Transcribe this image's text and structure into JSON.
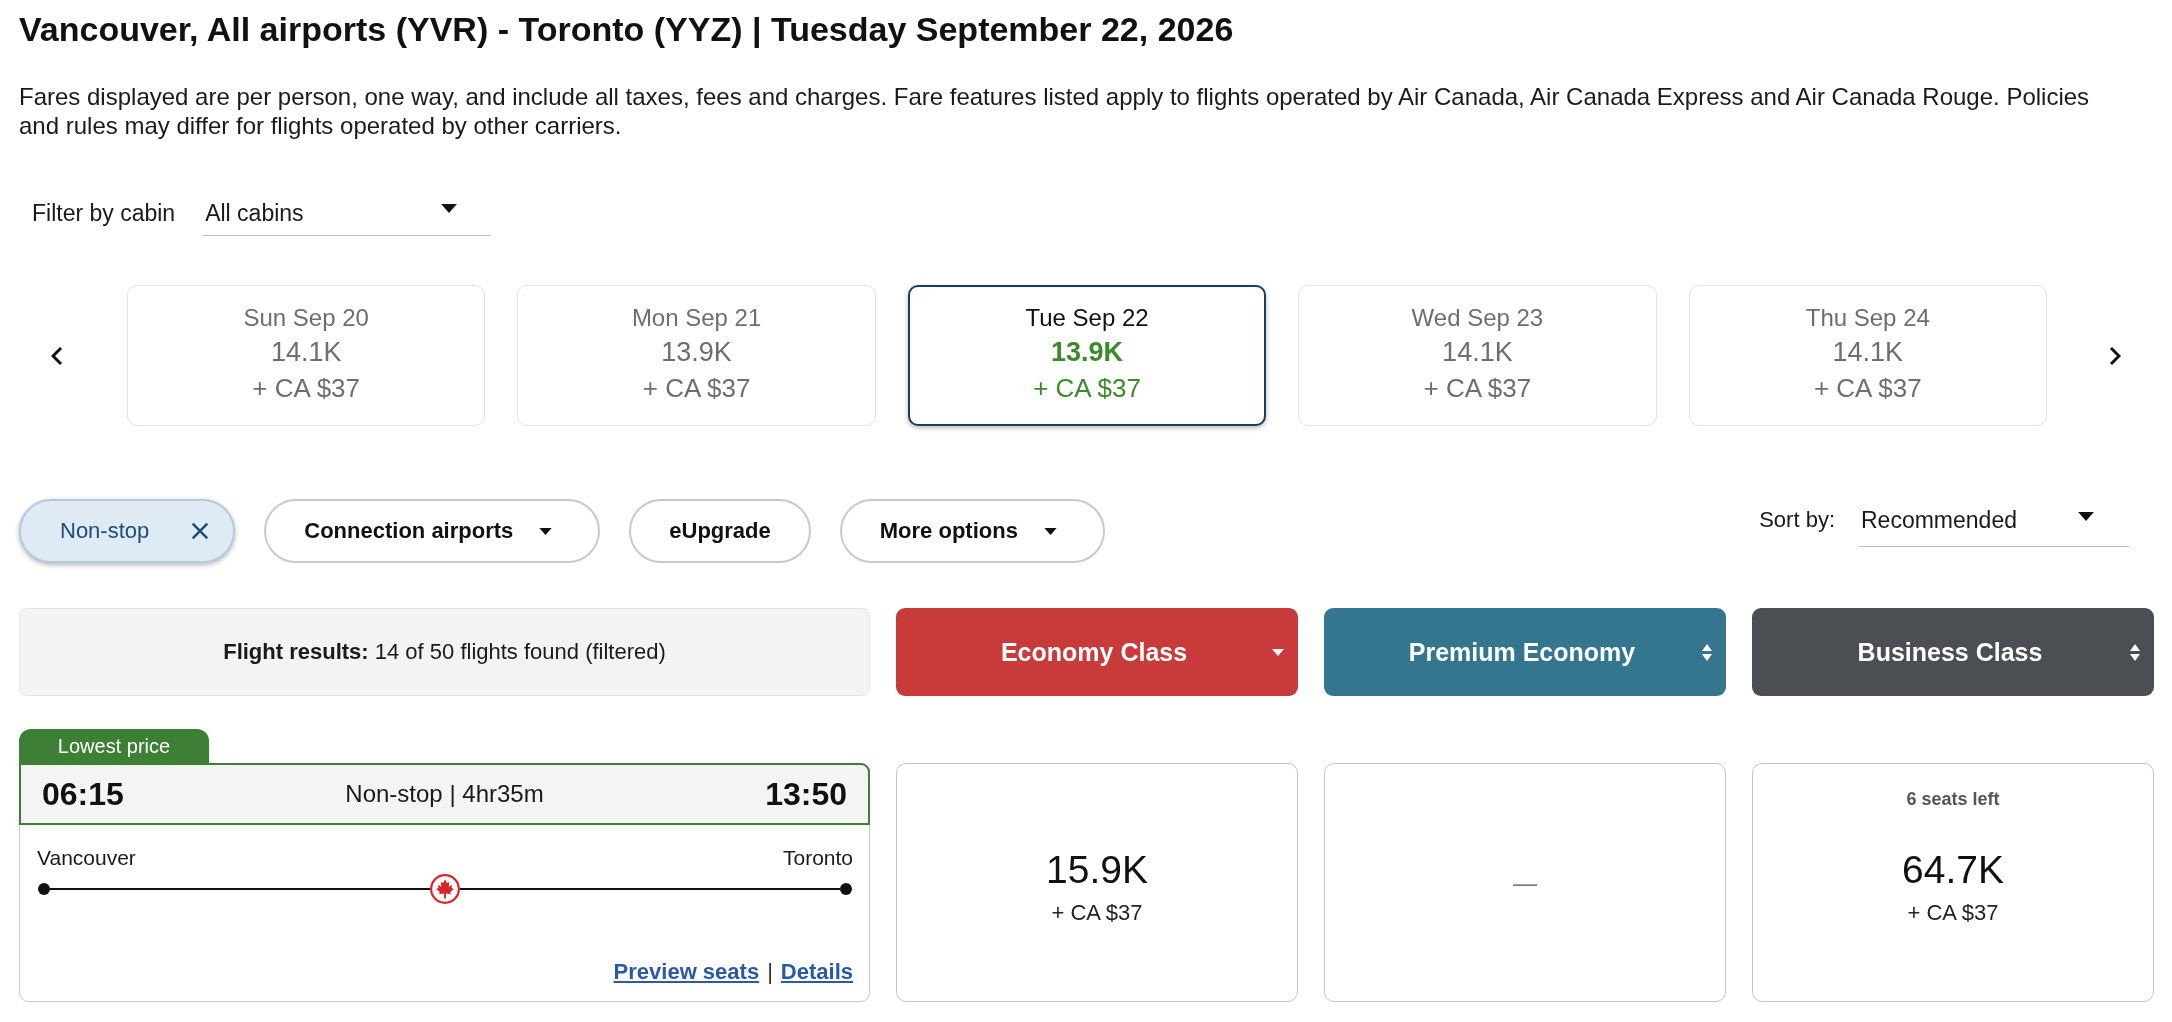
{
  "title": "Vancouver, All airports (YVR) - Toronto (YYZ) | Tuesday September 22, 2026",
  "notice": "Fares displayed are per person, one way, and include all taxes, fees and charges. Fare features listed apply to flights operated by Air Canada, Air Canada Express and Air Canada Rouge. Policies and rules may differ for flights operated by other carriers.",
  "cabin_filter": {
    "label": "Filter by cabin",
    "value": "All cabins"
  },
  "dates": [
    {
      "day": "Sun Sep 20",
      "points": "14.1K",
      "cash": "+ CA $37",
      "selected": false
    },
    {
      "day": "Mon Sep 21",
      "points": "13.9K",
      "cash": "+ CA $37",
      "selected": false
    },
    {
      "day": "Tue Sep 22",
      "points": "13.9K",
      "cash": "+ CA $37",
      "selected": true
    },
    {
      "day": "Wed Sep 23",
      "points": "14.1K",
      "cash": "+ CA $37",
      "selected": false
    },
    {
      "day": "Thu Sep 24",
      "points": "14.1K",
      "cash": "+ CA $37",
      "selected": false
    }
  ],
  "filters": [
    {
      "label": "Non-stop",
      "selected": true,
      "dropdown": false
    },
    {
      "label": "Connection airports",
      "selected": false,
      "dropdown": true
    },
    {
      "label": "eUpgrade",
      "selected": false,
      "dropdown": false
    },
    {
      "label": "More options",
      "selected": false,
      "dropdown": true
    }
  ],
  "sort": {
    "label": "Sort by:",
    "value": "Recommended"
  },
  "results": {
    "summary": "**Flight results:** 14 of 50 flights found (filtered)"
  },
  "cabins": [
    {
      "label": "Economy Class",
      "color": "#c83b3a",
      "sorted": true
    },
    {
      "label": "Premium Economy",
      "color": "#33768e",
      "sorted": false
    },
    {
      "label": "Business Class",
      "color": "#4b4e53",
      "sorted": false
    }
  ],
  "flights": [
    {
      "badge": "Lowest price",
      "departure": "06:15",
      "summary": "Non-stop | 4hr35m",
      "arrival": "13:50",
      "origin": "Vancouver",
      "destination": "Toronto",
      "links": [
        "Preview seats",
        "Details"
      ],
      "link_separator": "|",
      "fares": [
        {
          "kind": "price",
          "points": "15.9K",
          "cash": "+ CA $37"
        },
        {
          "kind": "unavailable",
          "text": "—"
        },
        {
          "kind": "price",
          "note": "6 seats left",
          "points": "64.7K",
          "cash": "+ CA $37"
        }
      ]
    }
  ]
}
